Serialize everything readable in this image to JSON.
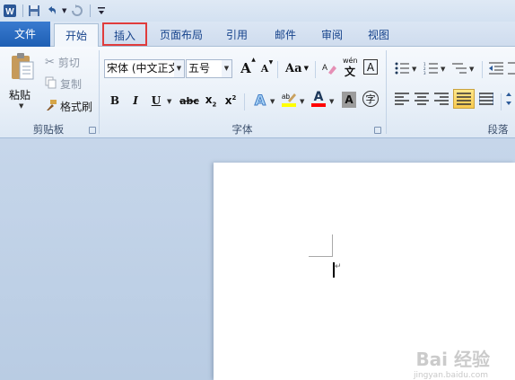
{
  "qat": {
    "app_icon": "word-icon",
    "save_icon": "save-icon",
    "undo_icon": "undo-icon",
    "redo_icon": "redo-icon",
    "customize_icon": "customize-qat-icon"
  },
  "tabs": {
    "file": "文件",
    "home": "开始",
    "insert": "插入",
    "layout": "页面布局",
    "references": "引用",
    "mailings": "邮件",
    "review": "审阅",
    "view": "视图"
  },
  "clipboard": {
    "paste": "粘贴",
    "cut": "剪切",
    "copy": "复制",
    "format_painter": "格式刷",
    "group_label": "剪贴板"
  },
  "font": {
    "font_name": "宋体 (中文正文)",
    "font_size": "五号",
    "grow": "A",
    "shrink": "A",
    "change_case": "Aa",
    "bold": "B",
    "italic": "I",
    "underline": "U",
    "strike": "abc",
    "subscript": "x",
    "superscript": "x",
    "sub_mark": "2",
    "sup_mark": "2",
    "phonetic": "wén",
    "phonetic_char": "文",
    "char_border": "A",
    "text_effect": "A",
    "font_color": "A",
    "char_shading": "A",
    "enclose": "字",
    "group_label": "字体",
    "highlight_color": "#ffff00",
    "font_color_value": "#ff0000"
  },
  "paragraph": {
    "group_label": "段落"
  },
  "watermark": {
    "text": "Bai 经验",
    "sub": "jingyan.baidu.com"
  }
}
